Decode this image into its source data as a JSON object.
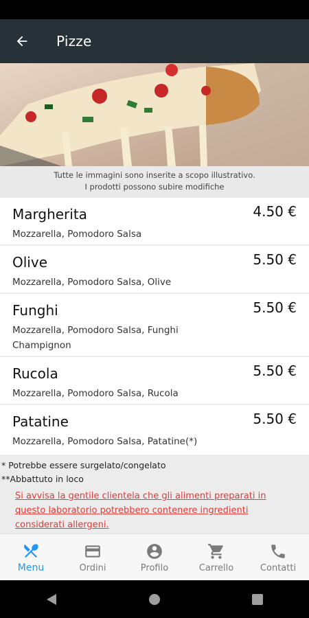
{
  "appbar": {
    "title": "Pizze",
    "back_icon": "arrow-back-icon"
  },
  "notice": {
    "line1": "Tutte le immagini sono inserite a scopo illustrativo.",
    "line2": "I prodotti possono subire modifiche"
  },
  "items": [
    {
      "name": "Margherita",
      "price": "4.50 €",
      "desc": "Mozzarella, Pomodoro Salsa"
    },
    {
      "name": "Olive",
      "price": "5.50 €",
      "desc": "Mozzarella, Pomodoro Salsa, Olive"
    },
    {
      "name": "Funghi",
      "price": "5.50 €",
      "desc": "Mozzarella, Pomodoro Salsa, Funghi Champignon"
    },
    {
      "name": "Rucola",
      "price": "5.50 €",
      "desc": "Mozzarella, Pomodoro Salsa, Rucola"
    },
    {
      "name": "Patatine",
      "price": "5.50 €",
      "desc": "Mozzarella, Pomodoro Salsa, Patatine(*)"
    }
  ],
  "footnotes": {
    "frozen": "* Potrebbe essere surgelato/congelato",
    "chilled": "**Abbattuto in loco",
    "allergen_warning": "Si avvisa la gentile clientela che gli alimenti preparati in questo laboratorio potrebbero contenere ingredienti considerati allergeni."
  },
  "nav": [
    {
      "label": "Menu",
      "icon": "fork-knife-icon",
      "active": true
    },
    {
      "label": "Ordini",
      "icon": "card-icon",
      "active": false
    },
    {
      "label": "Profilo",
      "icon": "account-circle-icon",
      "active": false
    },
    {
      "label": "Carrello",
      "icon": "cart-icon",
      "active": false
    },
    {
      "label": "Contatti",
      "icon": "phone-icon",
      "active": false
    }
  ],
  "colors": {
    "appbar": "#263238",
    "accent": "#2196f3",
    "warning": "#e53935"
  }
}
